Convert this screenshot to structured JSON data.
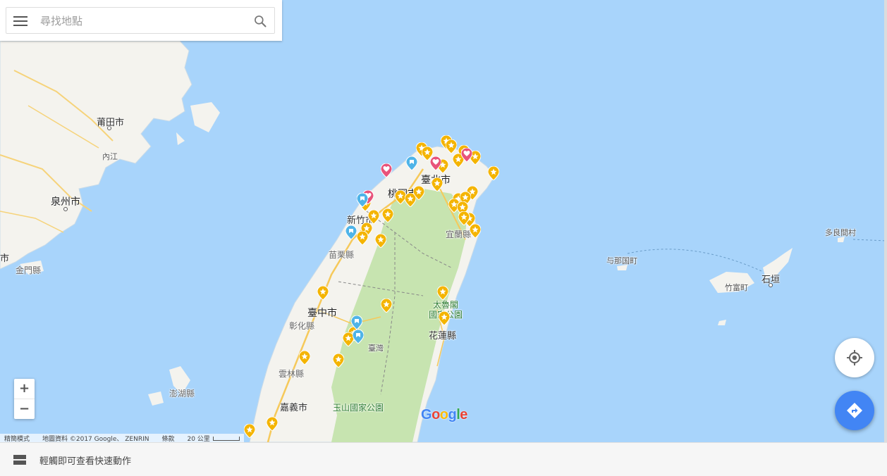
{
  "search": {
    "placeholder": "尋找地點",
    "menu_icon": "hamburger-menu-icon",
    "search_icon": "magnifier-icon"
  },
  "map": {
    "water_color": "#a8d4fb",
    "land_color": "#f4f3ee",
    "mountain_color": "#c7e4b0",
    "labels": {
      "putian": "莆田市",
      "quanzhou": "泉州市",
      "kinmen": "金門縣",
      "neijiang": "內江",
      "penghu": "澎湖縣",
      "taipei": "臺北市",
      "taoyuan": "桃園市",
      "hsinchu": "新竹市",
      "miaoli": "苗栗縣",
      "yilan": "宜蘭縣",
      "taichung": "臺中市",
      "changhua": "彰化縣",
      "taiwan": "臺灣",
      "hualien": "花蓮縣",
      "taroko": "太魯閣\n國家公園",
      "yunlin": "雲林縣",
      "chiayi": "嘉義市",
      "yushan": "玉山國家公園",
      "tarama": "多良間村",
      "yonaguni": "与那国町",
      "taketomi": "竹富町",
      "ishigaki": "石垣",
      "edge_left": "市"
    },
    "pins": {
      "star_color": "#f4b400",
      "pink_color": "#e8537a",
      "blue_color": "#4fb4e8"
    }
  },
  "controls": {
    "zoom_in": "+",
    "zoom_out": "−",
    "my_location_icon": "crosshair-target-icon",
    "directions_icon": "directions-arrow-icon"
  },
  "logo": {
    "letters": [
      "G",
      "o",
      "o",
      "g",
      "l",
      "e"
    ],
    "colors": [
      "#4285f4",
      "#ea4335",
      "#fbbc05",
      "#4285f4",
      "#34a853",
      "#ea4335"
    ]
  },
  "attribution": {
    "lite_mode": "精簡模式",
    "map_data": "地圖資料 ©2017 Google、 ZENRIN",
    "terms": "條款",
    "scale": "20 公里"
  },
  "bottom_bar": {
    "label": "輕觸即可查看快速動作",
    "icon": "quick-actions-icon"
  }
}
